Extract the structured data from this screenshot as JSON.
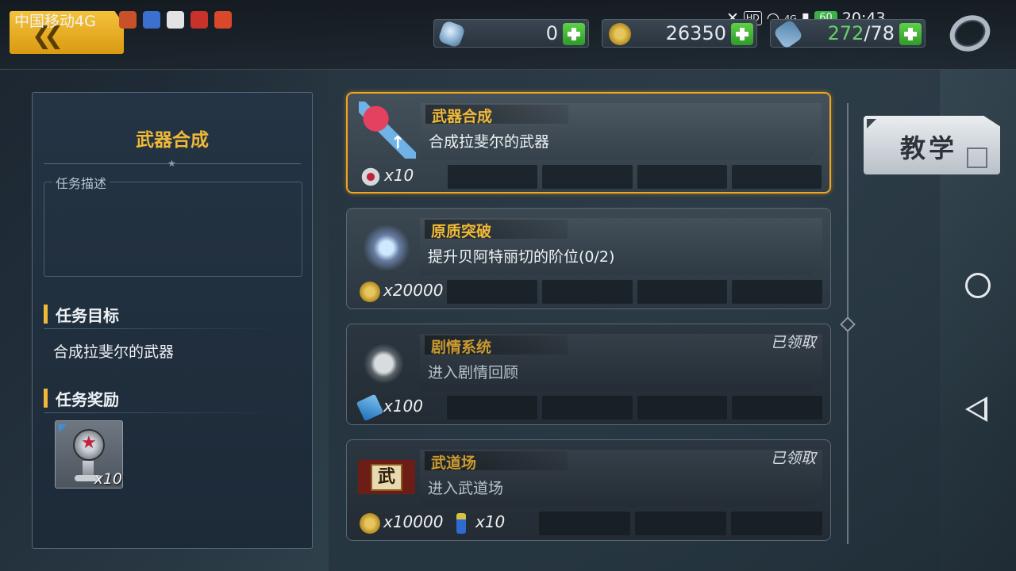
{
  "status_bar": {
    "carrier": "中国移动4G",
    "hd": "HD",
    "signal_4g": "4G",
    "battery": "60",
    "time": "20:43"
  },
  "resources": {
    "gems": "0",
    "gold": "26350",
    "stamina_current": "272",
    "stamina_max": "/78"
  },
  "left_panel": {
    "title": "武器合成",
    "desc_label": "任务描述",
    "goal_heading": "任务目标",
    "goal_text": "合成拉斐尔的武器",
    "reward_heading": "任务奖励",
    "reward_qty": "x10"
  },
  "quests": [
    {
      "name": "武器合成",
      "desc": "合成拉斐尔的武器",
      "status": "",
      "reward_qty": "x10",
      "reward_icon": "pentagram-icon"
    },
    {
      "name": "原质突破",
      "desc": "提升贝阿特丽切的阶位(0/2)",
      "status": "",
      "reward_qty": "x20000",
      "reward_icon": "gold-coin-icon"
    },
    {
      "name": "剧情系统",
      "desc": "进入剧情回顾",
      "status": "已领取",
      "reward_qty": "x100",
      "reward_icon": "ticket-icon"
    },
    {
      "name": "武道场",
      "desc": "进入武道场",
      "status": "已领取",
      "reward_qty": "x10000",
      "reward_qty_2": "x10",
      "reward_icon": "gold-coin-icon",
      "reward_icon_2": "exp-bottle-icon",
      "icon_char": "武"
    }
  ],
  "teach_button": "教学",
  "colors": {
    "accent": "#f0b936",
    "active_border": "#f0a61e",
    "plus_green": "#3fb236",
    "stamina_green": "#67d06a"
  }
}
